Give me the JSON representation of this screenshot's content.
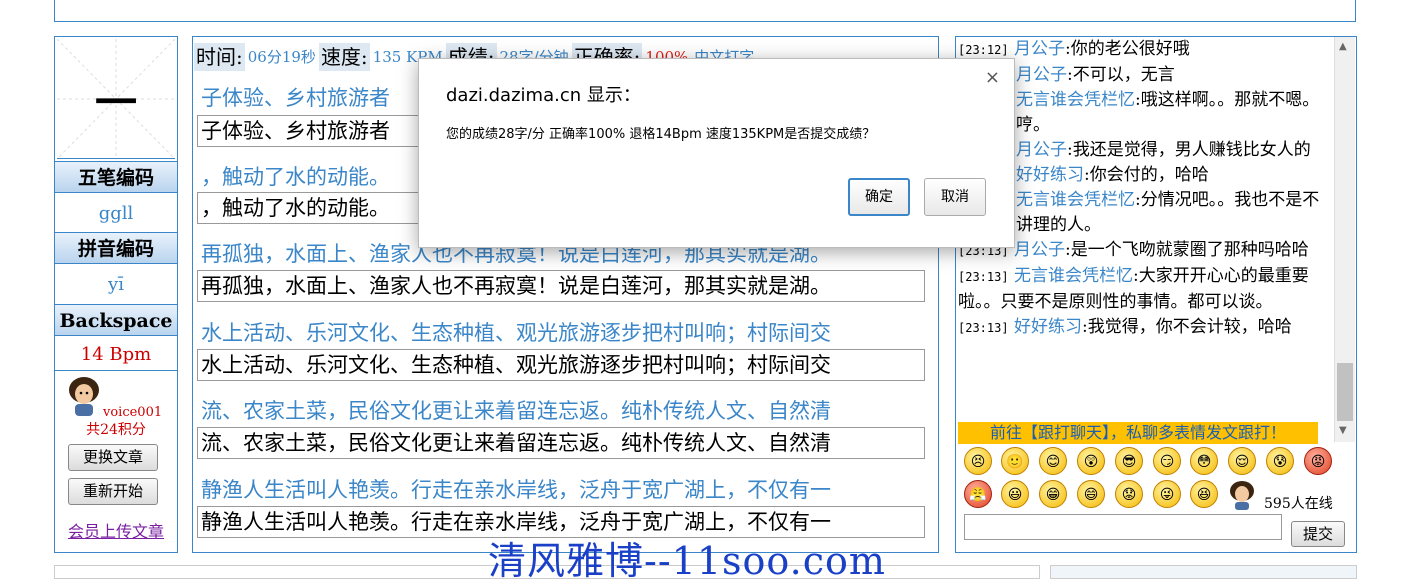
{
  "left": {
    "current_char": "一",
    "wubi_label": "五笔编码",
    "wubi_code": "ggll",
    "pinyin_label": "拼音编码",
    "pinyin": "yī",
    "backspace_label": "Backspace",
    "backspace_rate": "14 Bpm",
    "username": "voice001",
    "points": "共24积分",
    "change_article_btn": "更换文章",
    "restart_btn": "重新开始",
    "upload_link": "会员上传文章"
  },
  "stats": {
    "time_label": "时间:",
    "time_value": "06分19秒",
    "speed_label": "速度:",
    "speed_value": "135 KPM",
    "score_label": "成绩:",
    "score_value": "28字/分钟",
    "accuracy_label": "正确率:",
    "accuracy_value": "100%",
    "link": "中文打字"
  },
  "lines": [
    {
      "source": "子体验、乡村旅游者",
      "typed": "子体验、乡村旅游者"
    },
    {
      "source": "，触动了水的动能。",
      "typed": "，触动了水的动能。"
    },
    {
      "source": "再孤独，水面上、渔家人也不再寂寞！说是白莲河，那其实就是湖。",
      "typed": "再孤独，水面上、渔家人也不再寂寞！说是白莲河，那其实就是湖。"
    },
    {
      "source": "水上活动、乐河文化、生态种植、观光旅游逐步把村叫响；村际间交",
      "typed": "水上活动、乐河文化、生态种植、观光旅游逐步把村叫响；村际间交"
    },
    {
      "source": "流、农家土菜，民俗文化更让来着留连忘返。纯朴传统人文、自然清",
      "typed": "流、农家土菜，民俗文化更让来着留连忘返。纯朴传统人文、自然清"
    },
    {
      "source": "静渔人生活叫人艳羡。行走在亲水岸线，泛舟于宽广湖上，不仅有一",
      "typed": "静渔人生活叫人艳羡。行走在亲水岸线，泛舟于宽广湖上，不仅有一"
    }
  ],
  "chat": {
    "messages": [
      {
        "time": "[23:12]",
        "user": "月公子",
        "text": ":你的老公很好哦"
      },
      {
        "time": "",
        "user": "月公子",
        "text": ":不可以，无言"
      },
      {
        "time": "",
        "user": "无言谁会凭栏忆",
        "text": ":哦这样啊。。那就不嗯。哼。"
      },
      {
        "time": "",
        "user": "月公子",
        "text": ":我还是觉得，男人赚钱比女人的"
      },
      {
        "time": "",
        "user": "好好练习",
        "text": ":你会付的，哈哈"
      },
      {
        "time": "",
        "user": "无言谁会凭栏忆",
        "text": ":分情况吧。。我也不是不讲理的人。"
      },
      {
        "time": "[23:13]",
        "user": "月公子",
        "text": ":是一个飞吻就蒙圈了那种吗哈哈"
      },
      {
        "time": "[23:13]",
        "user": "无言谁会凭栏忆",
        "text": ":大家开开心心的最重要啦。。只要不是原则性的事情。都可以谈。"
      },
      {
        "time": "[23:13]",
        "user": "好好练习",
        "text": ":我觉得，你不会计较，哈哈"
      }
    ],
    "banner": "前往【跟打聊天】，私聊多表情发文跟打！",
    "online": "595人在线",
    "submit_btn": "提交",
    "input_value": ""
  },
  "watermark": "清风雅博--11soo.com",
  "dialog": {
    "title": "dazi.dazima.cn 显示：",
    "message": "您的成绩28字/分 正确率100% 退格14Bpm 速度135KPM是否提交成绩？",
    "ok": "确定",
    "cancel": "取消",
    "close": "×"
  },
  "colors": {
    "accent": "#3a86c8",
    "red": "#e0201a",
    "banner": "#ffc000"
  }
}
